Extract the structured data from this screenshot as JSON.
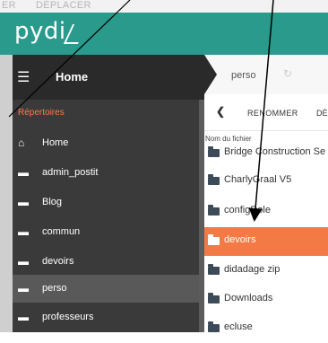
{
  "top": {
    "left_cut": "ER",
    "action": "DÉPLACER"
  },
  "brand": {
    "logo": "pydi"
  },
  "header": {
    "menu_icon": "hamburger-icon",
    "title": "Home"
  },
  "sidebar": {
    "section": "Répertoires",
    "items": [
      {
        "label": "Home",
        "icon": "home-icon"
      },
      {
        "label": "admin_postit",
        "icon": "folder-icon"
      },
      {
        "label": "Blog",
        "icon": "folder-icon"
      },
      {
        "label": "commun",
        "icon": "folder-icon"
      },
      {
        "label": "devoirs",
        "icon": "folder-icon"
      },
      {
        "label": "perso",
        "icon": "folder-icon",
        "active": true
      },
      {
        "label": "professeurs",
        "icon": "folder-icon"
      }
    ]
  },
  "breadcrumb": {
    "current": "perso",
    "refresh_icon": "refresh-icon"
  },
  "toolbar": {
    "back": "❮",
    "rename": "RENOMMER",
    "more": "DÉ"
  },
  "files": {
    "column": "Nom du fichier",
    "items": [
      {
        "name": "Bridge Construction Se"
      },
      {
        "name": "CharlyGraal V5"
      },
      {
        "name": "configDole"
      },
      {
        "name": "devoirs",
        "active": true
      },
      {
        "name": "didadage zip"
      },
      {
        "name": "Downloads"
      },
      {
        "name": "ecluse"
      }
    ]
  },
  "colors": {
    "brand": "#2a9a8c",
    "accent": "#f47a45",
    "sidebar": "#3a3a3a"
  }
}
